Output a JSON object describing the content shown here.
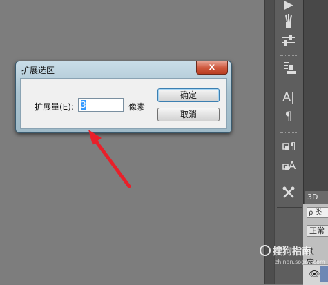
{
  "dialog": {
    "title": "扩展选区",
    "close": "x",
    "field_label": "扩展量(E):",
    "field_value": "3",
    "unit": "像素",
    "ok_label": "确定",
    "cancel_label": "取消"
  },
  "panel": {
    "tab_label": "3D",
    "search_text": "ρ 类",
    "blend_mode": "正常",
    "lock_label": "锁定："
  },
  "toolbar": {
    "icons": [
      "play-icon",
      "brush-presets-icon",
      "adjust-icon",
      "clone-source-icon",
      "character-icon",
      "paragraph-icon",
      "character-styles-icon",
      "paragraph-styles-icon",
      "tools-icon"
    ],
    "text_glyphs": {
      "character": "A|",
      "paragraph": "¶"
    }
  },
  "watermark": {
    "text": "搜狗指南",
    "sub": "zhinan.sogou.com"
  },
  "colors": {
    "arrow": "#e8202a",
    "dialog_frame": "#a9c3d0",
    "close_button": "#cf5a3f",
    "selection": "#3399ff"
  }
}
